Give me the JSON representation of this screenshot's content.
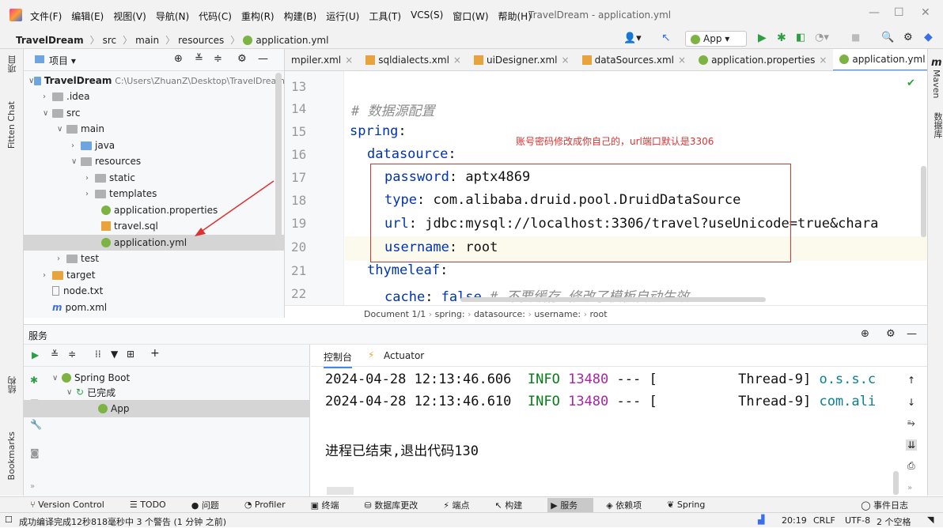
{
  "window": {
    "menu": [
      "文件(F)",
      "编辑(E)",
      "视图(V)",
      "导航(N)",
      "代码(C)",
      "重构(R)",
      "构建(B)",
      "运行(U)",
      "工具(T)",
      "VCS(S)",
      "窗口(W)",
      "帮助(H)"
    ],
    "title": "TravelDream - application.yml"
  },
  "navbar": {
    "crumbs": [
      "TravelDream",
      "src",
      "main",
      "resources",
      "application.yml"
    ],
    "run_config": "App"
  },
  "left_strip": {
    "project": "项目",
    "fitten": "Fitten Chat",
    "structure": "结构",
    "bookmarks": "Bookmarks"
  },
  "right_strip": {
    "maven": "Maven",
    "database": "数据库"
  },
  "project": {
    "header": "项目",
    "tree": [
      {
        "label": "TravelDream",
        "path": "C:\\Users\\ZhuanZ\\Desktop\\TravelDream"
      },
      {
        "label": ".idea"
      },
      {
        "label": "src"
      },
      {
        "label": "main"
      },
      {
        "label": "java"
      },
      {
        "label": "resources"
      },
      {
        "label": "static"
      },
      {
        "label": "templates"
      },
      {
        "label": "application.properties"
      },
      {
        "label": "travel.sql"
      },
      {
        "label": "application.yml"
      },
      {
        "label": "test"
      },
      {
        "label": "target"
      },
      {
        "label": "node.txt"
      },
      {
        "label": "pom.xml"
      }
    ]
  },
  "tabs": [
    {
      "label": "mpiler.xml"
    },
    {
      "label": "sqldialects.xml"
    },
    {
      "label": "uiDesigner.xml"
    },
    {
      "label": "dataSources.xml"
    },
    {
      "label": "application.properties"
    },
    {
      "label": "application.yml"
    }
  ],
  "editor": {
    "line_numbers": [
      "13",
      "14",
      "15",
      "16",
      "17",
      "18",
      "19",
      "20",
      "21",
      "22"
    ],
    "comment1": "# 数据源配置",
    "spring_key": "spring",
    "datasource_key": "datasource",
    "password_key": "password",
    "password_val": "aptx4869",
    "type_key": "type",
    "type_val": "com.alibaba.druid.pool.DruidDataSource",
    "url_key": "url",
    "url_val": "jdbc:mysql://localhost:3306/travel?useUnicode=true&chara",
    "username_key": "username",
    "username_val": "root",
    "thymeleaf_key": "thymeleaf",
    "cache_key": "cache",
    "cache_val": "false",
    "cache_comment": "# 不要缓存 修改了模板自动生效",
    "annotation": "账号密码修改成你自己的，url端口默认是3306",
    "breadcrumb": [
      "Document 1/1",
      "spring:",
      "datasource:",
      "username:",
      "root"
    ]
  },
  "services": {
    "title": "服务",
    "tree": [
      "Spring Boot",
      "已完成",
      "App"
    ],
    "tabs": [
      "控制台",
      "Actuator"
    ],
    "console": [
      {
        "time": "2024-04-28 12:13:46.606",
        "level": "INFO",
        "pid": "13480",
        "dash": "--- [",
        "thread": "Thread-9]",
        "cls": "o.s.s.c"
      },
      {
        "time": "2024-04-28 12:13:46.610",
        "level": "INFO",
        "pid": "13480",
        "dash": "--- [",
        "thread": "Thread-9]",
        "cls": "com.ali"
      }
    ],
    "exit_msg": "进程已结束,退出代码130"
  },
  "toolwindows": [
    "Version Control",
    "TODO",
    "问题",
    "Profiler",
    "终端",
    "数据库更改",
    "端点",
    "构建",
    "服务",
    "依赖项",
    "Spring"
  ],
  "event_log": "事件日志",
  "status": {
    "message": "成功编译完成12秒818毫秒中 3 个警告 (1 分钟 之前)",
    "position": "20:19",
    "line_sep": "CRLF",
    "encoding": "UTF-8",
    "indent": "2 个空格"
  }
}
